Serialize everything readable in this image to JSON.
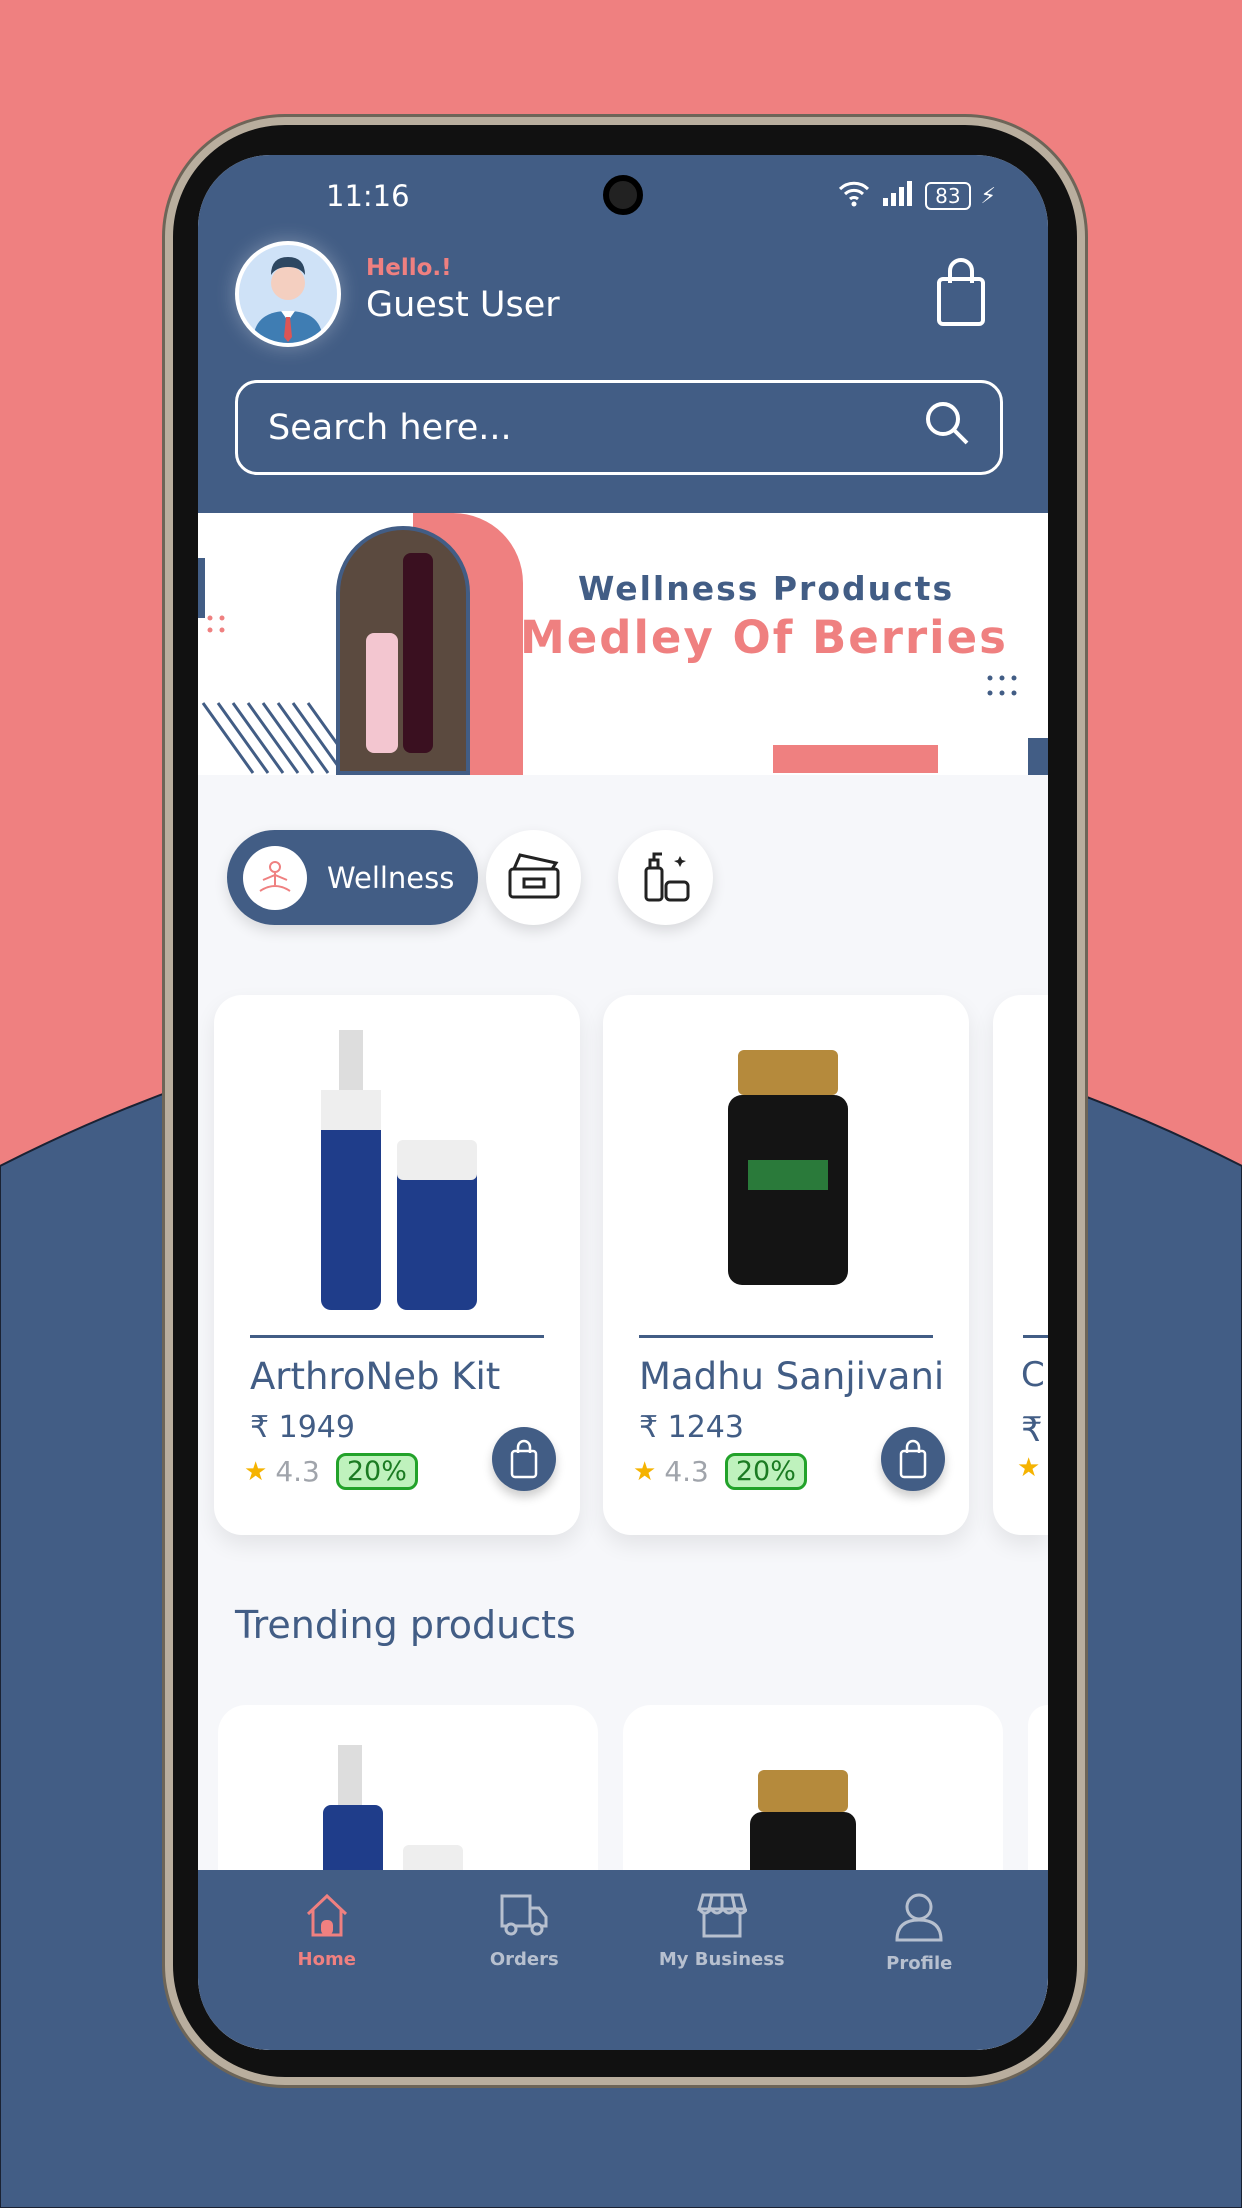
{
  "colors": {
    "primary": "#425d85",
    "accent": "#ef8080",
    "discount": "#1b7b22"
  },
  "status": {
    "time": "11:16",
    "battery": "83"
  },
  "header": {
    "greeting": "Hello.!",
    "user": "Guest User"
  },
  "search": {
    "placeholder": "Search here..."
  },
  "banner": {
    "subtitle": "Wellness Products",
    "title": "Medley Of Berries"
  },
  "categories": [
    {
      "label": "Wellness",
      "icon": "meditation-icon",
      "active": true
    },
    {
      "icon": "kit-box-icon"
    },
    {
      "icon": "personal-care-icon"
    }
  ],
  "products": [
    {
      "name": "ArthroNeb Kit",
      "price": "₹ 1949",
      "rating": "4.3",
      "discount": "20%"
    },
    {
      "name": "Madhu Sanjivani",
      "price": "₹ 1243",
      "rating": "4.3",
      "discount": "20%"
    },
    {
      "name": "C",
      "price": "₹",
      "rating": "",
      "discount": ""
    }
  ],
  "trending": {
    "title": "Trending products"
  },
  "nav": [
    {
      "label": "Home",
      "icon": "home-icon"
    },
    {
      "label": "Orders",
      "icon": "truck-icon"
    },
    {
      "label": "My Business",
      "icon": "store-icon"
    },
    {
      "label": "Profile",
      "icon": "user-icon"
    }
  ]
}
